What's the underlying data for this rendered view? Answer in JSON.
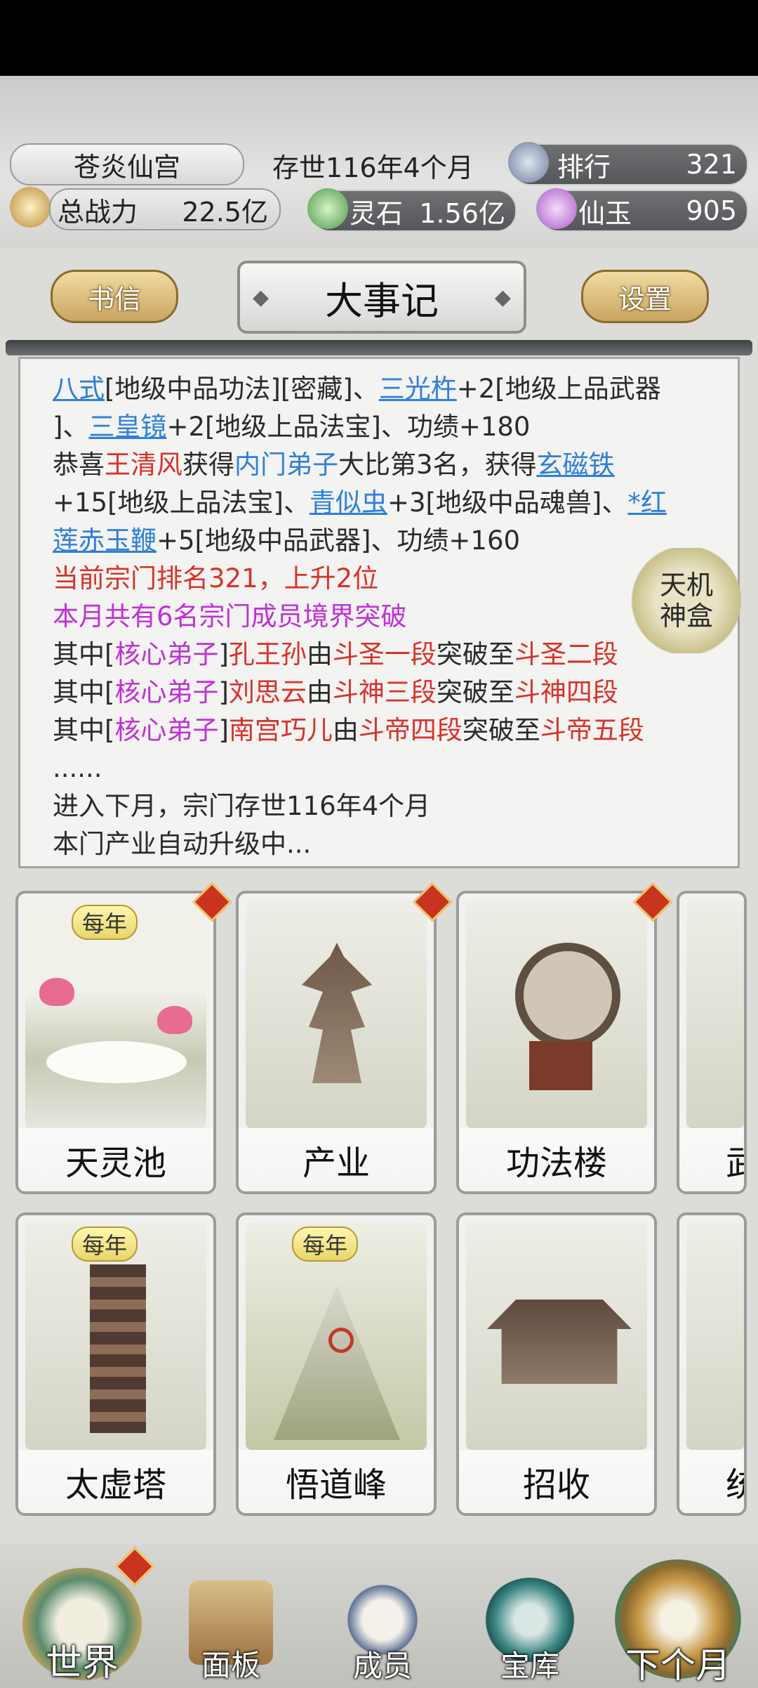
{
  "header": {
    "sect_name": "苍炎仙宫",
    "existence": "存世116年4个月",
    "rank_label": "排行",
    "rank_value": "321",
    "power_label": "总战力",
    "power_value": "22.5亿",
    "spirit_stone_label": "灵石",
    "spirit_stone_value": "1.56亿",
    "jade_label": "仙玉",
    "jade_value": "905"
  },
  "tabs": {
    "letters": "书信",
    "title": "大事记",
    "settings": "设置"
  },
  "log": {
    "l1": {
      "a": "八式",
      "b": "[地级中品功法][密藏]、",
      "c": "三光杵",
      "d": "+2[地级上品武器"
    },
    "l2": {
      "a": "]、",
      "b": "三皇镜",
      "c": "+2[地级上品法宝]、功绩+180"
    },
    "l3": {
      "a": "恭喜",
      "b": "王清风",
      "c": "获得",
      "d": "内门弟子",
      "e": "大比第3名，获得",
      "f": "玄磁铁"
    },
    "l4": {
      "a": "+15[地级上品法宝]、",
      "b": "青似虫",
      "c": "+3[地级中品魂兽]、",
      "d": "*红"
    },
    "l5": {
      "a": "莲赤玉鞭",
      "b": "+5[地级中品武器]、功绩+160"
    },
    "l6": "当前宗门排名321，上升2位",
    "l7": "本月共有6名宗门成员境界突破",
    "l8": {
      "a": "其中[",
      "b": "核心弟子",
      "c": "]",
      "d": "孔王孙",
      "e": "由",
      "f": "斗圣一段",
      "g": "突破至",
      "h": "斗圣二段"
    },
    "l9": {
      "a": "其中[",
      "b": "核心弟子",
      "c": "]",
      "d": "刘思云",
      "e": "由",
      "f": "斗神三段",
      "g": "突破至",
      "h": "斗神四段"
    },
    "l10": {
      "a": "其中[",
      "b": "核心弟子",
      "c": "]",
      "d": "南宫巧儿",
      "e": "由",
      "f": "斗帝四段",
      "g": "突破至",
      "h": "斗帝五段"
    },
    "l11": "......",
    "l12": "进入下月，宗门存世116年4个月",
    "l13": "本门产业自动升级中..."
  },
  "treasure_box": {
    "line1": "天机",
    "line2": "神盒"
  },
  "buildings": [
    {
      "name": "天灵池",
      "badge": "每年"
    },
    {
      "name": "产业",
      "badge": ""
    },
    {
      "name": "功法楼",
      "badge": ""
    },
    {
      "name": "武",
      "badge": ""
    },
    {
      "name": "太虚塔",
      "badge": "每年"
    },
    {
      "name": "悟道峰",
      "badge": "每年"
    },
    {
      "name": "招收",
      "badge": ""
    },
    {
      "name": "统",
      "badge": ""
    }
  ],
  "nav": {
    "world": "世界",
    "panel": "面板",
    "members": "成员",
    "treasury": "宝库",
    "next_month": "下个月"
  },
  "colors": {
    "link": "#2f80d8",
    "event": "#d7332a",
    "rank": "#c031d6",
    "gold": "#c9a560"
  }
}
